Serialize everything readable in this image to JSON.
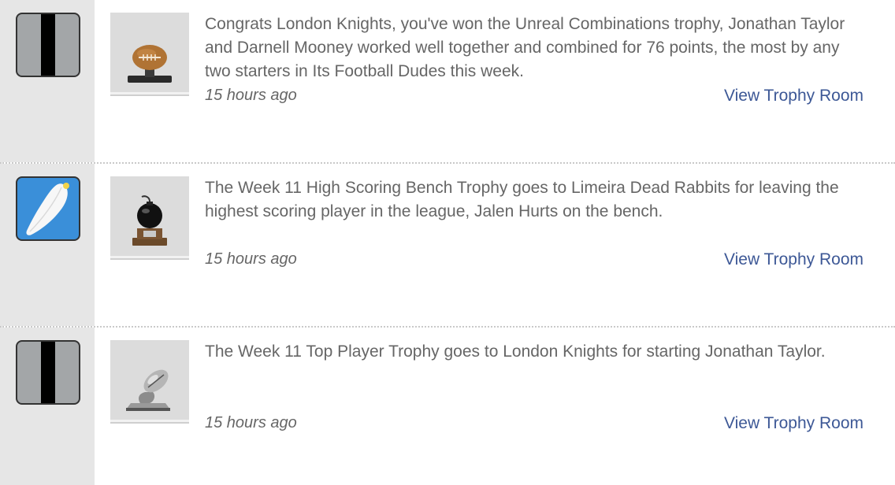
{
  "feed": {
    "items": [
      {
        "avatar_icon": "striped-team-icon",
        "trophy_icon": "football-trophy-icon",
        "message": "Congrats London Knights, you've won the Unreal Combinations trophy, Jonathan Taylor and Darnell Mooney worked well together and combined for 76 points, the most by any two starters in Its Football Dudes this week.",
        "time": "15 hours ago",
        "link": "View Trophy Room"
      },
      {
        "avatar_icon": "feather-team-icon",
        "trophy_icon": "bomb-trophy-icon",
        "message": "The Week 11 High Scoring Bench Trophy goes to Limeira Dead Rabbits for leaving the highest scoring player in the league, Jalen Hurts on the bench.",
        "time": "15 hours ago",
        "link": "View Trophy Room"
      },
      {
        "avatar_icon": "striped-team-icon",
        "trophy_icon": "silver-football-trophy-icon",
        "message": "The Week 11 Top Player Trophy goes to London Knights for starting Jonathan Taylor.",
        "time": "15 hours ago",
        "link": "View Trophy Room"
      }
    ]
  },
  "colors": {
    "link": "#3d5896",
    "text": "#666666",
    "sidebar": "#e6e6e6",
    "avatar_blue": "#3a8fd9"
  }
}
